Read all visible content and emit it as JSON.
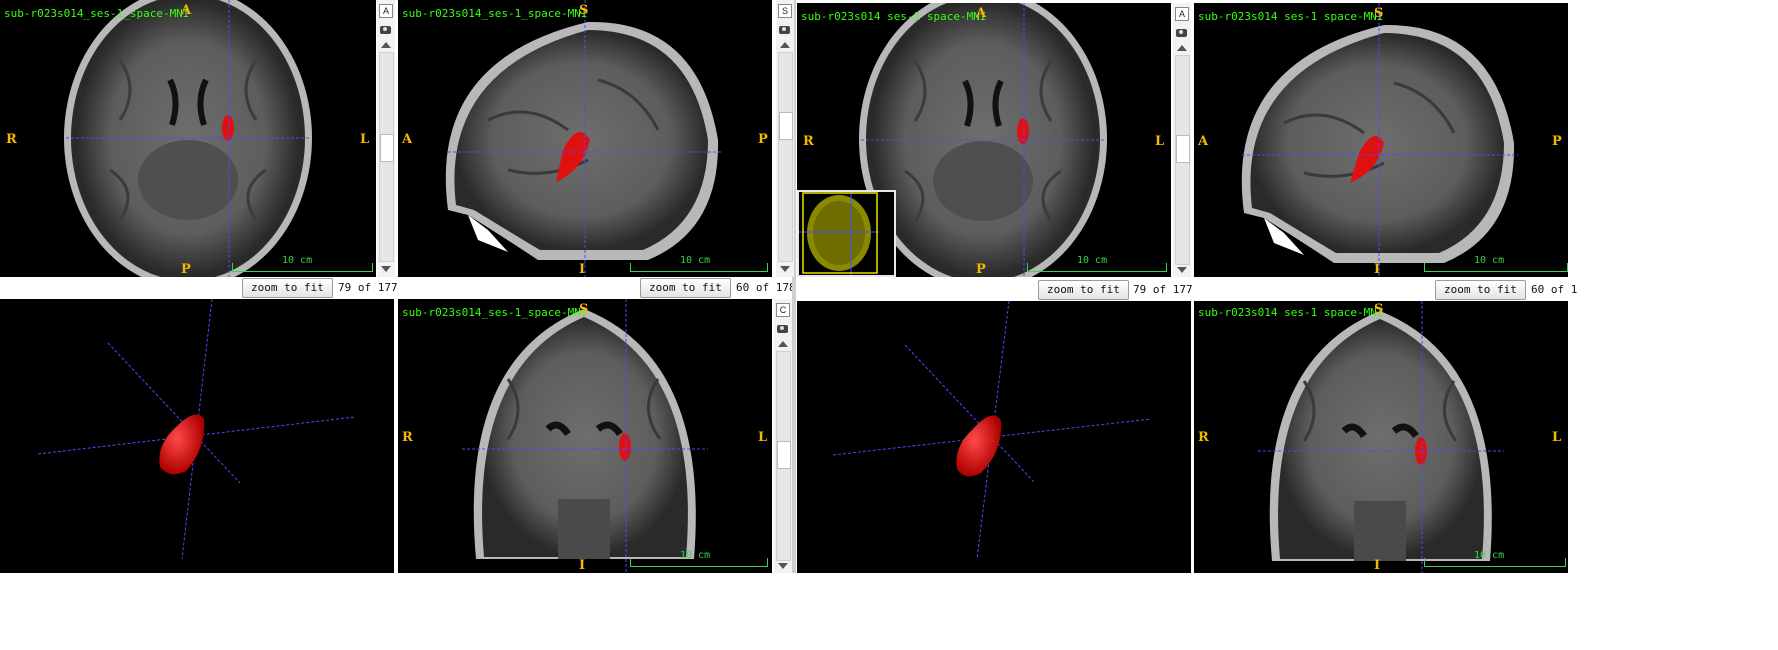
{
  "left": {
    "axial": {
      "label": "sub-r023s014_ses-1_space-MNI",
      "orient": {
        "top": "A",
        "bottom": "P",
        "left": "R",
        "right": "L"
      },
      "scale": "10 cm",
      "zoom": "zoom to fit",
      "slice": "79 of 177"
    },
    "sagittal": {
      "label": "sub-r023s014_ses-1_space-MNI",
      "orient": {
        "top": "S",
        "bottom": "I",
        "left": "A",
        "right": "P"
      },
      "scale": "10 cm",
      "zoom": "zoom to fit",
      "slice": "60 of 178"
    },
    "coronal": {
      "label": "sub-r023s014_ses-1_space-MNI",
      "orient": {
        "top": "S",
        "bottom": "I",
        "left": "R",
        "right": "L"
      },
      "scale": "10 cm"
    },
    "strip1": {
      "btn": "A"
    },
    "strip2": {
      "btn": "C"
    }
  },
  "right": {
    "axial": {
      "label": "sub-r023s014 ses-1 space-MNI",
      "orient": {
        "top": "A",
        "bottom": "P",
        "left": "R",
        "right": "L"
      },
      "scale": "10 cm",
      "zoom": "zoom to fit",
      "slice": "79 of 177"
    },
    "sagittal": {
      "label": "sub-r023s014 ses-1 space-MNI",
      "orient": {
        "top": "S",
        "bottom": "I",
        "left": "A",
        "right": "P"
      },
      "scale": "10 cm",
      "zoom": "zoom to fit",
      "slice": "60 of 1"
    },
    "coronal": {
      "label": "sub-r023s014 ses-1 space-MNI",
      "orient": {
        "top": "S",
        "bottom": "I",
        "left": "R",
        "right": "L"
      },
      "scale": "10 cm"
    },
    "strip_left": {
      "btn": "S"
    },
    "strip1": {
      "btn": "A"
    }
  },
  "colors": {
    "crosshair": "#4a4aff",
    "lesion": "#e01010",
    "label": "#39ff14",
    "orient": "#f5b800",
    "scale": "#39d353"
  },
  "icons": [
    "camera-icon",
    "arrow-up-icon",
    "arrow-down-icon"
  ]
}
